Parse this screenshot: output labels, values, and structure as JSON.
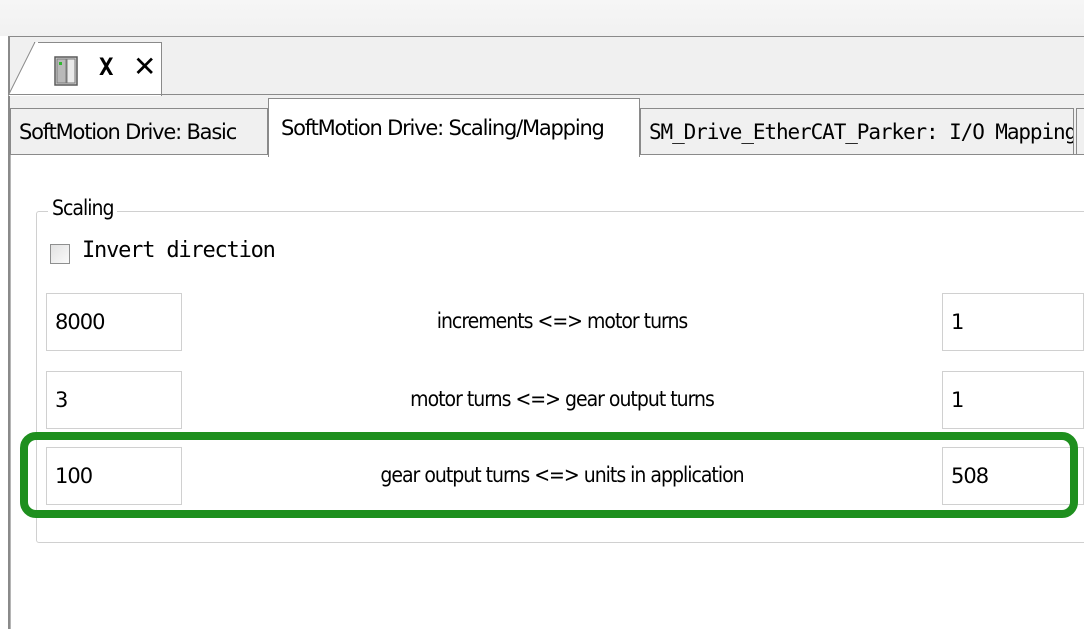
{
  "document_tab": {
    "title": "X",
    "close_symbol": "✕",
    "icon": "device-icon"
  },
  "tabs": [
    {
      "label": "SoftMotion Drive: Basic",
      "active": false
    },
    {
      "label": "SoftMotion Drive: Scaling/Mapping",
      "active": true
    },
    {
      "label": "SM_Drive_EtherCAT_Parker: I/O Mapping",
      "active": false
    }
  ],
  "scaling": {
    "group_title": "Scaling",
    "invert_direction": {
      "label": "Invert direction",
      "checked": false
    },
    "rows": [
      {
        "left_value": "8000",
        "label": "increments <=> motor turns",
        "right_value": "1"
      },
      {
        "left_value": "3",
        "label": "motor turns <=> gear output turns",
        "right_value": "1"
      },
      {
        "left_value": "100",
        "label": "gear output turns <=> units in application",
        "right_value": "508"
      }
    ]
  },
  "colors": {
    "highlight": "#1e8f1e",
    "tab_border": "#8a8a8a",
    "panel_bg": "#ffffff",
    "frame_bg": "#f0f0f0"
  }
}
